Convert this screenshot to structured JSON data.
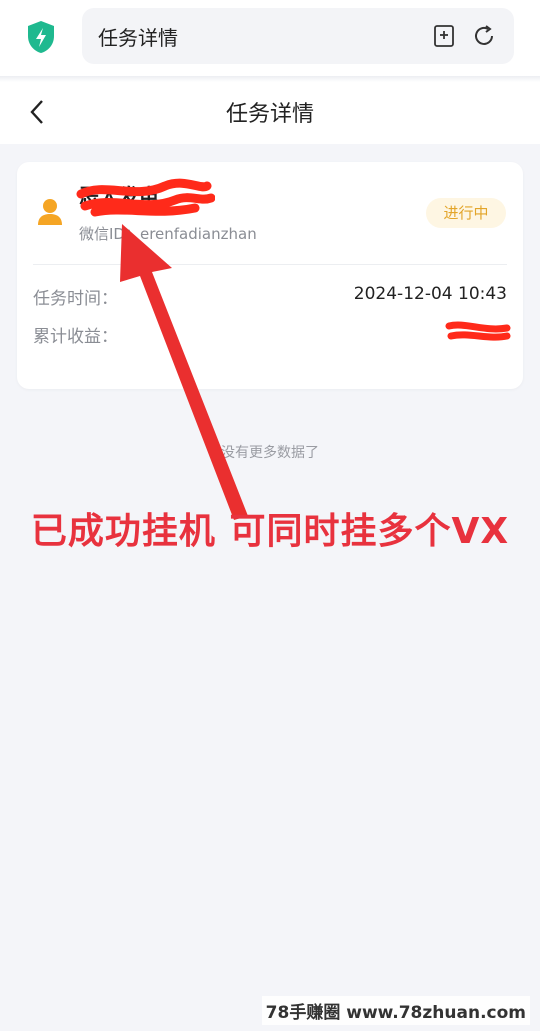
{
  "browser": {
    "url_title": "任务详情",
    "icons": [
      "shield-icon",
      "bookmark-add-icon",
      "refresh-icon"
    ]
  },
  "header": {
    "title": "任务详情",
    "back_icon": "chevron-left-icon"
  },
  "card": {
    "user_name": "恶人发电",
    "wechat_id": "微信ID：erenfadianzhan",
    "status": "进行中",
    "rows": [
      {
        "label": "任务时间：",
        "value": "2024-12-04 10:43"
      },
      {
        "label": "累计收益：",
        "value": ""
      }
    ]
  },
  "footer": {
    "no_more": "没有更多数据了"
  },
  "annotation": {
    "caption": "已成功挂机 可同时挂多个VX"
  },
  "watermark": "78手赚圈 www.78zhuan.com",
  "colors": {
    "accent_green": "#1fb98f",
    "status_orange": "#e3a52a",
    "status_bg": "#fef6e3",
    "annotation_red": "#e8323e",
    "user_icon": "#f5a524"
  }
}
